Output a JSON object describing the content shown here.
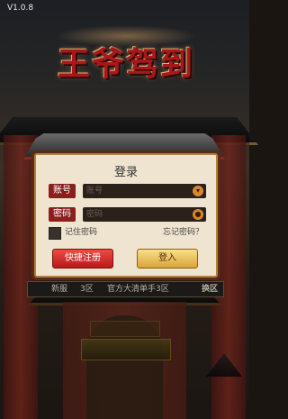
{
  "version": "V1.0.8",
  "logo": {
    "text": "王爷驾到"
  },
  "login": {
    "title": "登录",
    "account_label": "账号",
    "account_placeholder": "账号",
    "password_label": "密码",
    "password_placeholder": "密码",
    "remember_label": "记住密码",
    "forgot_label": "忘记密码？",
    "register_button": "快捷注册",
    "login_button": "登入"
  },
  "server": {
    "badge": "新服",
    "number": "3区",
    "name": "官方大清单手3区",
    "switch": "换区"
  },
  "colors": {
    "primary_red": "#8a1f1c",
    "gold": "#d9a43a",
    "panel_bg": "#efe4d0"
  }
}
